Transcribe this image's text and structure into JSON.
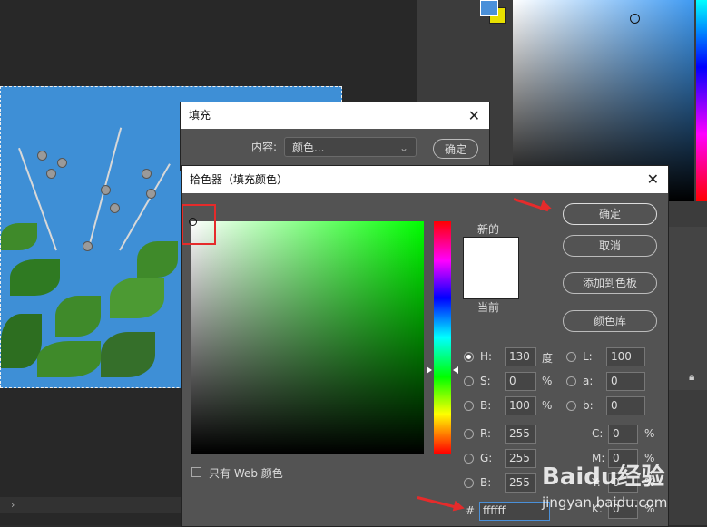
{
  "background": {
    "statusbar_arrow": "›"
  },
  "fill_dialog": {
    "title": "填充",
    "content_label": "内容:",
    "content_value": "颜色...",
    "ok_label": "确定"
  },
  "color_picker": {
    "title": "拾色器（填充颜色）",
    "new_label": "新的",
    "current_label": "当前",
    "buttons": {
      "ok": "确定",
      "cancel": "取消",
      "add_swatch": "添加到色板",
      "color_library": "颜色库"
    },
    "hsb": [
      {
        "label": "H:",
        "value": "130",
        "unit": "度",
        "selected": true
      },
      {
        "label": "S:",
        "value": "0",
        "unit": "%",
        "selected": false
      },
      {
        "label": "B:",
        "value": "100",
        "unit": "%",
        "selected": false
      }
    ],
    "rgb": [
      {
        "label": "R:",
        "value": "255"
      },
      {
        "label": "G:",
        "value": "255"
      },
      {
        "label": "B:",
        "value": "255"
      }
    ],
    "lab": [
      {
        "label": "L:",
        "value": "100"
      },
      {
        "label": "a:",
        "value": "0"
      },
      {
        "label": "b:",
        "value": "0"
      }
    ],
    "cmyk": [
      {
        "label": "C:",
        "value": "0",
        "unit": "%"
      },
      {
        "label": "M:",
        "value": "0",
        "unit": "%"
      },
      {
        "label": "Y:",
        "value": "0",
        "unit": "%"
      },
      {
        "label": "K:",
        "value": "0",
        "unit": "%"
      }
    ],
    "web_only_label": "只有 Web 颜色",
    "hex_label": "#",
    "hex_value": "ffffff",
    "current_color": "#ffffff",
    "hue_color": "#00ff2b"
  },
  "watermark": {
    "text": "Baidu经验",
    "sub": "jingyan.baidu.com"
  }
}
